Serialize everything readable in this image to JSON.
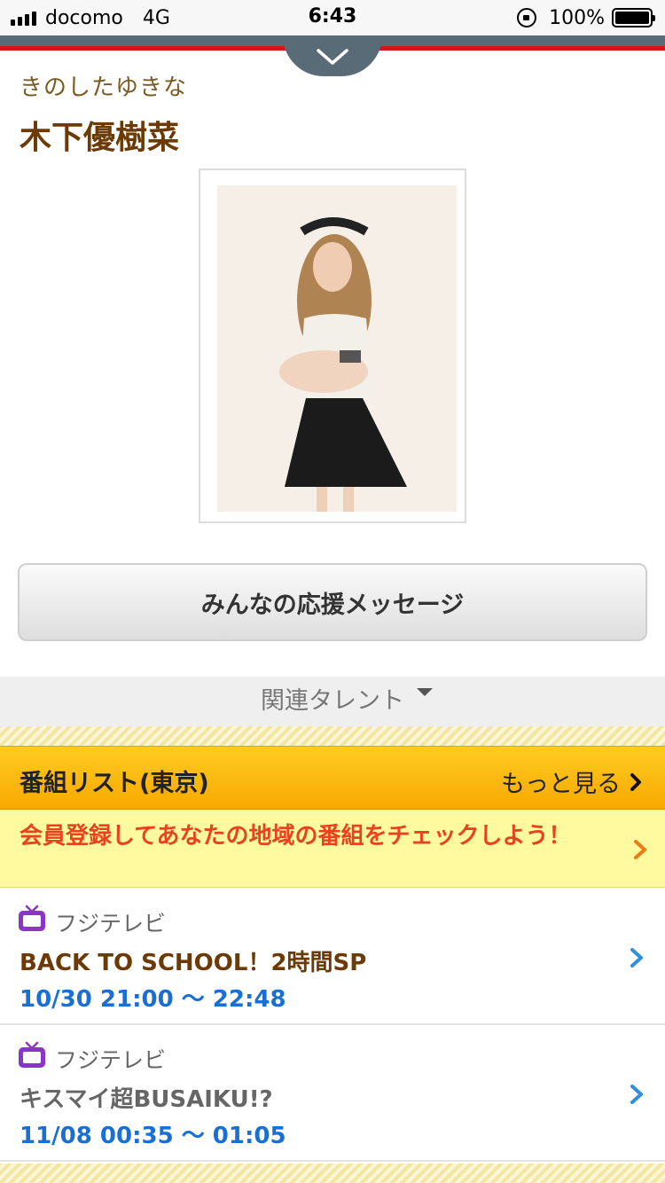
{
  "status_bar": {
    "carrier": "docomo",
    "network": "4G",
    "time": "6:43",
    "battery": "100%"
  },
  "profile": {
    "kana": "きのしたゆきな",
    "name": "木下優樹菜"
  },
  "support_button": "みんなの応援メッセージ",
  "related": {
    "label": "関連タレント"
  },
  "program_list": {
    "title": "番組リスト(東京)",
    "more": "もっと見る",
    "notice": "会員登録してあなたの地域の番組をチェックしよう！",
    "items": [
      {
        "channel": "フジテレビ",
        "title": "BACK TO SCHOOL！2時間SP",
        "time": "10/30 21:00 〜 22:48"
      },
      {
        "channel": "フジテレビ",
        "title": "キスマイ超BUSAIKU!?",
        "time": "11/08 00:35 〜 01:05"
      }
    ]
  },
  "colors": {
    "accent_red": "#d8141c",
    "name_brown": "#6b3a06",
    "time_blue": "#1a6fd4",
    "notice_orange": "#e8431c",
    "header_yellow": "#ffcc22"
  }
}
